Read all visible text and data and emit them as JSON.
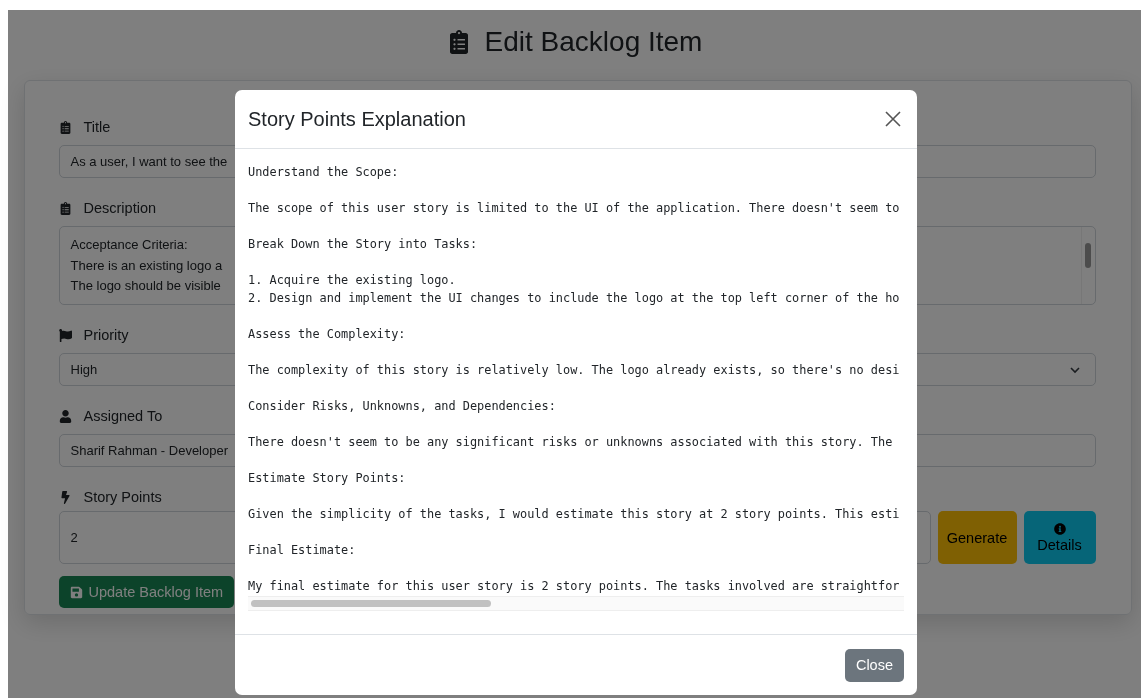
{
  "page_title": "Edit Backlog Item",
  "fields": [
    {
      "kind": "text",
      "label": "Title",
      "value": "As a user, I want to see the"
    },
    {
      "kind": "textarea",
      "label": "Description",
      "lines": [
        "Acceptance Criteria:",
        "There is an existing logo a",
        "The logo should be visible"
      ]
    },
    {
      "kind": "select",
      "label": "Priority",
      "value": "High"
    },
    {
      "kind": "text",
      "label": "Assigned To",
      "value": "Sharif Rahman - Developer"
    },
    {
      "kind": "points",
      "label": "Story Points",
      "value": "2",
      "buttons": [
        "Generate",
        "Details"
      ]
    }
  ],
  "submit_button": "Update Backlog Item",
  "modal": {
    "title": "Story Points Explanation",
    "close_button": "Close",
    "blocks": [
      [
        "Understand the Scope:"
      ],
      [
        "The scope of this user story is limited to the UI of the application. There doesn't seem to"
      ],
      [
        "Break Down the Story into Tasks:"
      ],
      [
        "1. Acquire the existing logo.",
        "2. Design and implement the UI changes to include the logo at the top left corner of the ho"
      ],
      [
        "Assess the Complexity:"
      ],
      [
        "The complexity of this story is relatively low. The logo already exists, so there's no desi"
      ],
      [
        "Consider Risks, Unknowns, and Dependencies:"
      ],
      [
        "There doesn't seem to be any significant risks or unknowns associated with this story. The"
      ],
      [
        "Estimate Story Points:"
      ],
      [
        "Given the simplicity of the tasks, I would estimate this story at 2 story points. This esti"
      ],
      [
        "Final Estimate:"
      ],
      [
        "My final estimate for this user story is 2 story points. The tasks involved are straightfor"
      ]
    ]
  }
}
